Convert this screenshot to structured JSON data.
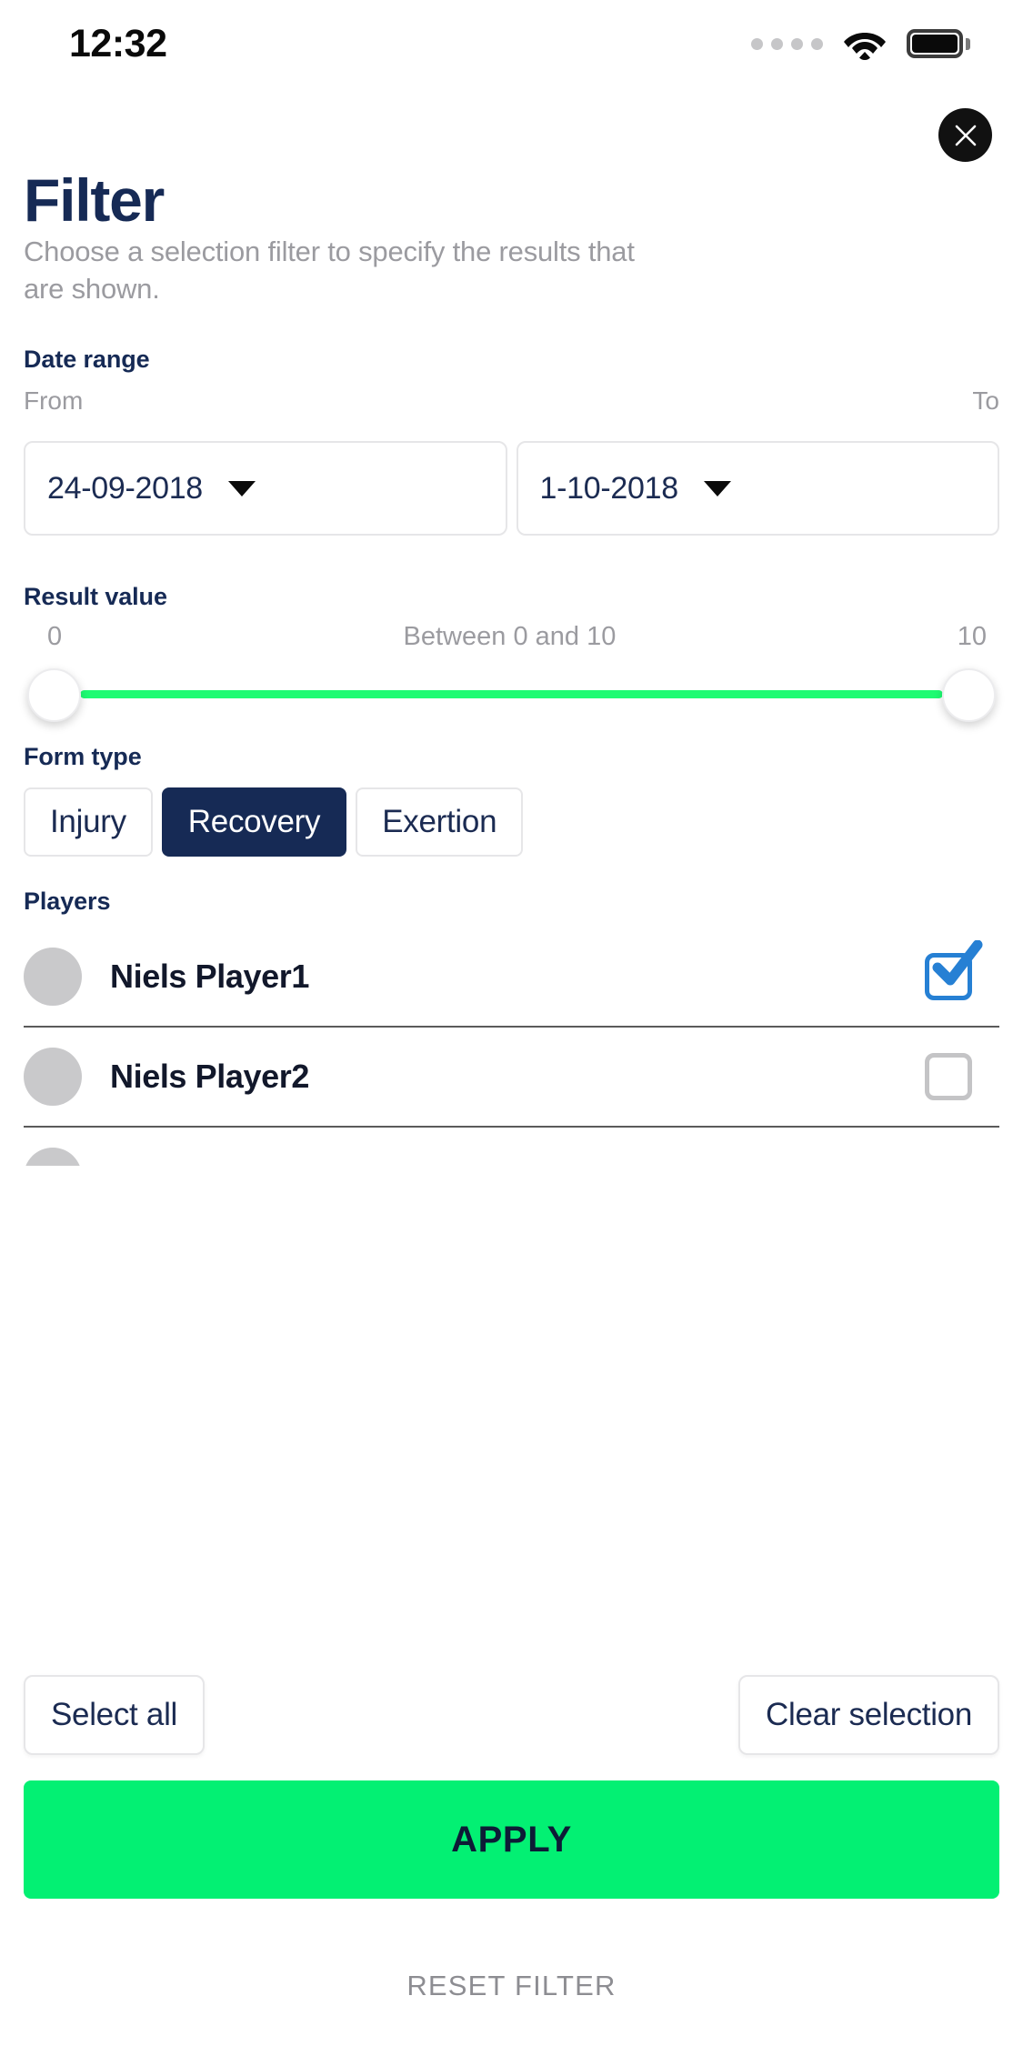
{
  "status_bar": {
    "time": "12:32",
    "signal_icon": "signal-dots-icon",
    "wifi_icon": "wifi-icon",
    "battery_icon": "battery-full-icon"
  },
  "header": {
    "close_icon": "close-icon",
    "title": "Filter",
    "subtitle": "Choose a selection filter to specify the results that are shown."
  },
  "date_range": {
    "section_label": "Date range",
    "from_label": "From",
    "to_label": "To",
    "from_value": "24-09-2018",
    "to_value": "1-10-2018",
    "caret_icon": "chevron-down-icon"
  },
  "result_value": {
    "section_label": "Result value",
    "min_label": "0",
    "max_label": "10",
    "range_text": "Between 0 and 10",
    "min_value": 0,
    "max_value": 10,
    "track_color": "#1efb72"
  },
  "form_type": {
    "section_label": "Form type",
    "options": [
      {
        "label": "Injury",
        "selected": false
      },
      {
        "label": "Recovery",
        "selected": true
      },
      {
        "label": "Exertion",
        "selected": false
      }
    ],
    "selected_color": "#162a55"
  },
  "players": {
    "section_label": "Players",
    "items": [
      {
        "name": "Niels Player1",
        "checked": true
      },
      {
        "name": "Niels Player2",
        "checked": false
      }
    ],
    "checked_color": "#2680d4",
    "unchecked_color": "#c4c4c6"
  },
  "actions": {
    "select_all_label": "Select all",
    "clear_selection_label": "Clear selection",
    "apply_label": "APPLY",
    "apply_color": "#03f073",
    "reset_label": "RESET FILTER"
  }
}
